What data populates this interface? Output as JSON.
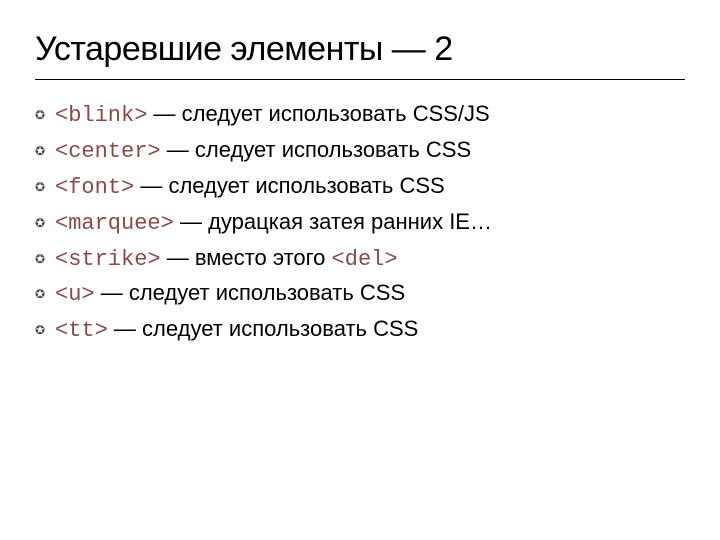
{
  "slide": {
    "title": "Устаревшие элементы — 2"
  },
  "items": [
    {
      "tag_open": "<",
      "tag_name": "blink",
      "tag_close": ">",
      "sep": " — ",
      "desc": "следует использовать CSS/JS"
    },
    {
      "tag_open": "<",
      "tag_name": "center",
      "tag_close": ">",
      "sep": " — ",
      "desc": "следует использовать CSS"
    },
    {
      "tag_open": "<",
      "tag_name": "font",
      "tag_close": ">",
      "sep": " — ",
      "desc": "следует использовать CSS"
    },
    {
      "tag_open": "<",
      "tag_name": "marquee",
      "tag_close": ">",
      "sep": " — ",
      "desc": "дурацкая затея ранних IE…"
    },
    {
      "tag_open": "<",
      "tag_name": "strike",
      "tag_close": ">",
      "sep": " — ",
      "desc_pre": "вместо этого ",
      "desc_tag_open": "<",
      "desc_tag_name": "del",
      "desc_tag_close": ">"
    },
    {
      "tag_open": "<",
      "tag_name": "u",
      "tag_close": ">",
      "sep": " — ",
      "desc": "следует использовать CSS"
    },
    {
      "tag_open": "<",
      "tag_name": "tt",
      "tag_close": ">",
      "sep": " — ",
      "desc": "следует использовать CSS"
    }
  ],
  "icons": {
    "bullet": "✪"
  }
}
